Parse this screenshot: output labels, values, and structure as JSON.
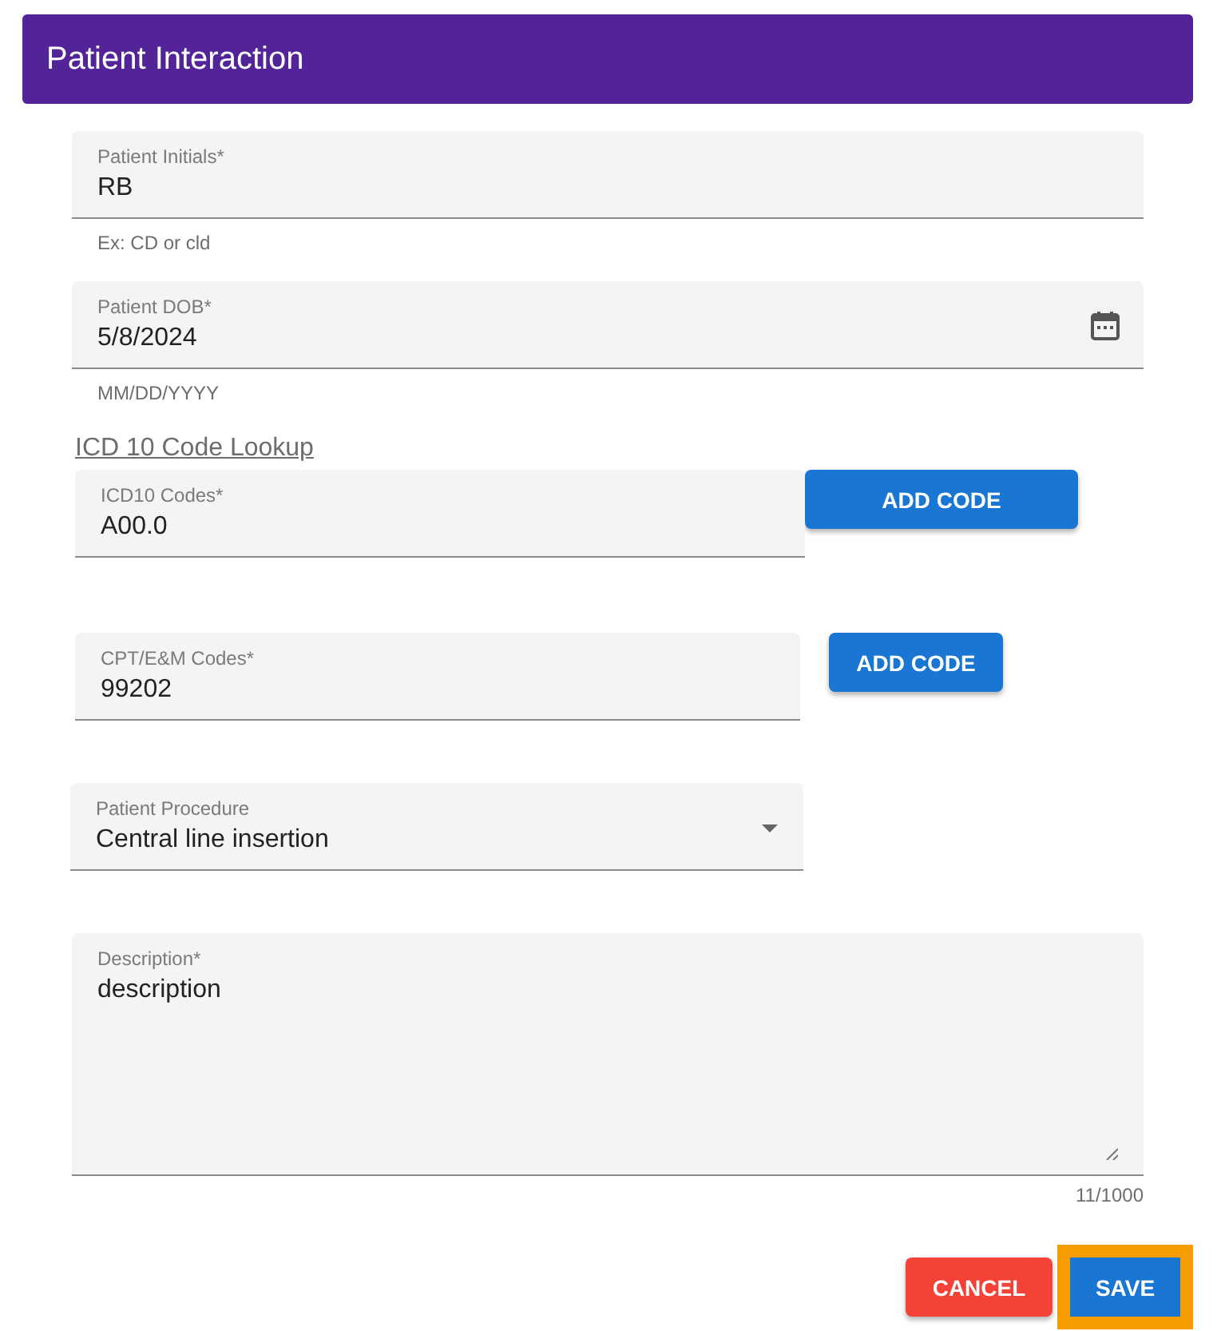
{
  "header": {
    "title": "Patient Interaction"
  },
  "fields": [
    {
      "kind": "text",
      "label": "Patient Initials*",
      "value": "RB",
      "helper": "Ex: CD or cld"
    },
    {
      "kind": "date",
      "label": "Patient DOB*",
      "value": "5/8/2024",
      "helper": "MM/DD/YYYY"
    }
  ],
  "lookup_link": "ICD 10 Code Lookup",
  "code_fields": [
    {
      "label": "ICD10 Codes*",
      "value": "A00.0",
      "button": "ADD CODE"
    },
    {
      "label": "CPT/E&M Codes*",
      "value": "99202",
      "button": "ADD CODE"
    }
  ],
  "procedure": {
    "label": "Patient Procedure",
    "value": "Central line insertion"
  },
  "description": {
    "label": "Description*",
    "value": "description",
    "counter": "11/1000"
  },
  "actions": [
    {
      "kind": "cancel",
      "label": "CANCEL",
      "focused": false
    },
    {
      "kind": "save",
      "label": "SAVE",
      "focused": true
    }
  ]
}
